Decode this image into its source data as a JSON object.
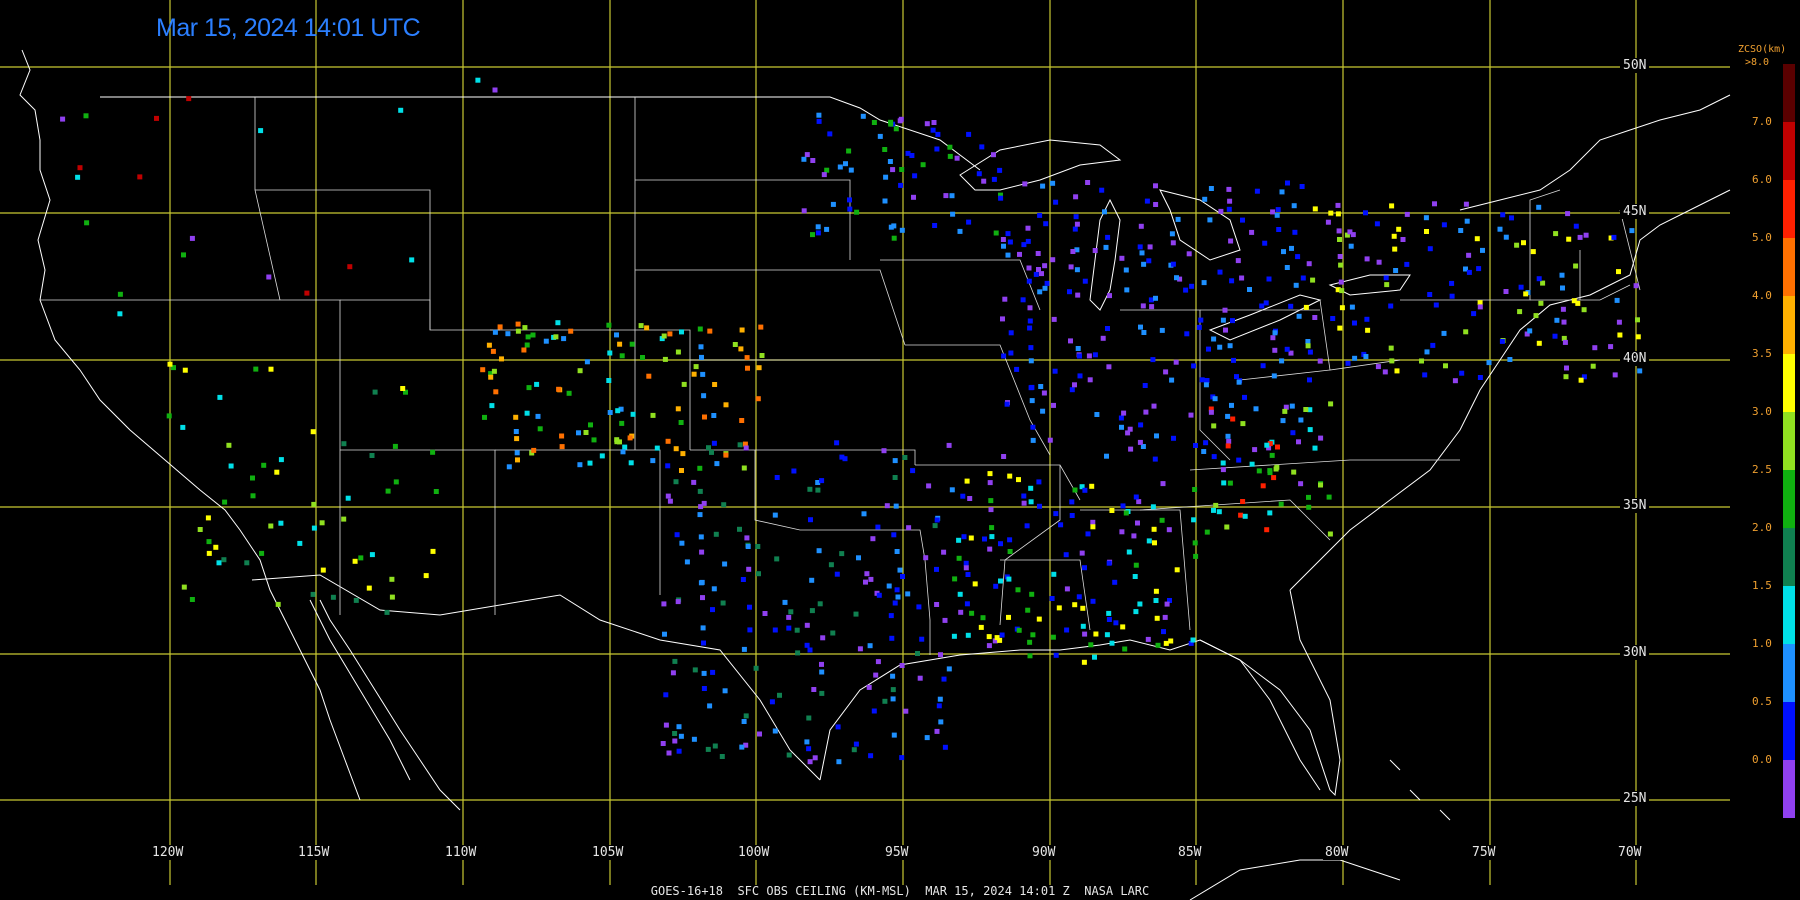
{
  "timestamp": "Mar 15, 2024 14:01 UTC",
  "footer": "GOES-16+18  SFC OBS CEILING (KM-MSL)  MAR 15, 2024 14:01 Z  NASA LARC",
  "lat_labels": [
    "50N",
    "45N",
    "40N",
    "35N",
    "30N",
    "25N"
  ],
  "lon_labels": [
    "120W",
    "115W",
    "110W",
    "105W",
    "100W",
    "95W",
    "90W",
    "85W",
    "80W",
    "75W",
    "70W"
  ],
  "legend": {
    "title": "ZCSO(km)",
    "top_label": ">8.0",
    "ticks": [
      "7.0",
      "6.0",
      "5.0",
      "4.0",
      "3.5",
      "3.0",
      "2.5",
      "2.0",
      "1.5",
      "1.0",
      "0.5",
      "0.0"
    ],
    "colors": [
      "#5a0000",
      "#c00000",
      "#ff2000",
      "#ff7000",
      "#ffb000",
      "#ffff00",
      "#90e020",
      "#10b010",
      "#108050",
      "#00e0e8",
      "#1e90ff",
      "#0010ff",
      "#9040f0"
    ]
  },
  "colors": {
    "grid": "#c8c832",
    "border": "#ffffff",
    "timestamp": "#2b7fff"
  }
}
